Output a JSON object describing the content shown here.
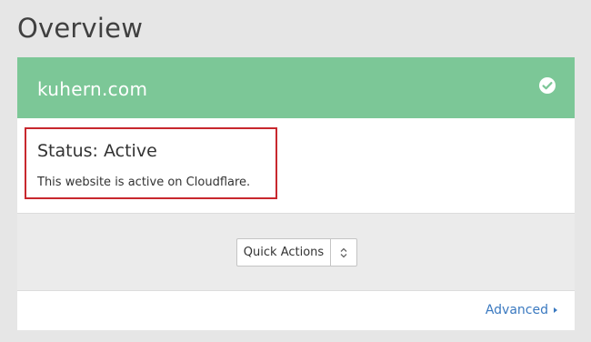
{
  "page": {
    "title": "Overview"
  },
  "site": {
    "domain": "kuhern.com"
  },
  "status": {
    "title": "Status: Active",
    "description": "This website is active on Cloudflare."
  },
  "actions": {
    "quick_actions_label": "Quick Actions"
  },
  "footer": {
    "advanced_label": "Advanced"
  },
  "colors": {
    "banner": "#7cc797",
    "highlight": "#c8282e",
    "link": "#3a79c0"
  },
  "icons": {
    "status": "check-circle-icon",
    "select": "up-down-arrows-icon",
    "link": "caret-right-icon"
  }
}
